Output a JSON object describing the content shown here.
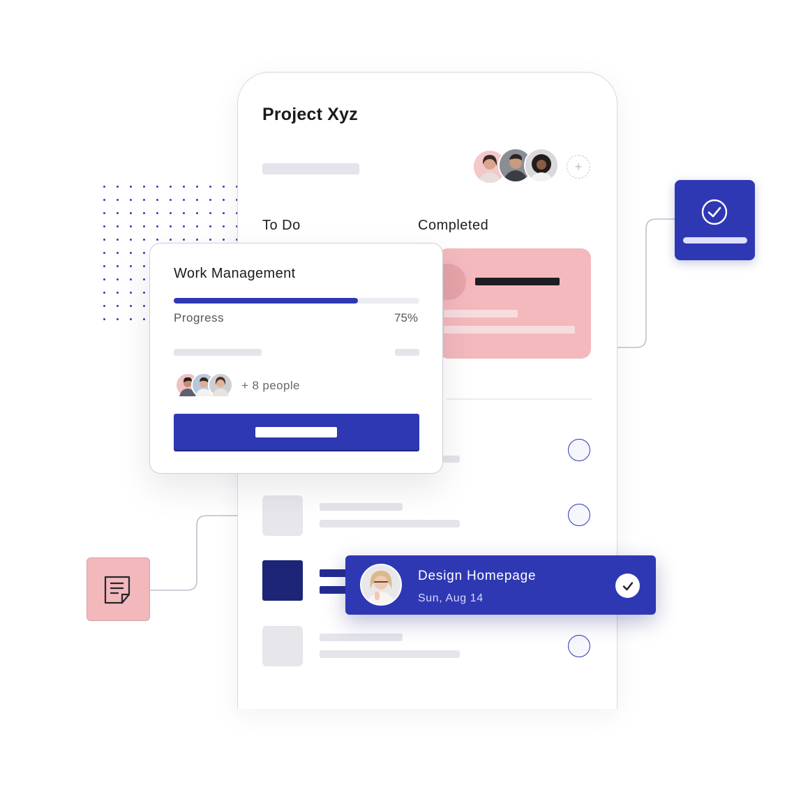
{
  "project": {
    "title": "Project Xyz",
    "add_member_icon": "plus-icon"
  },
  "columns": {
    "todo": "To Do",
    "completed": "Completed"
  },
  "work_card": {
    "title": "Work Management",
    "progress_label": "Progress",
    "progress_value": 0.75,
    "progress_text": "75%",
    "people_text": "+ 8 people"
  },
  "task": {
    "title": "Design Homepage",
    "date": "Sun, Aug 14",
    "check_icon": "check-icon"
  },
  "side_tiles": {
    "done_icon": "check-circle-icon",
    "note_icon": "note-icon"
  },
  "colors": {
    "accent": "#2f38b3",
    "pink": "#f3b9bd",
    "navy": "#1d2577"
  }
}
